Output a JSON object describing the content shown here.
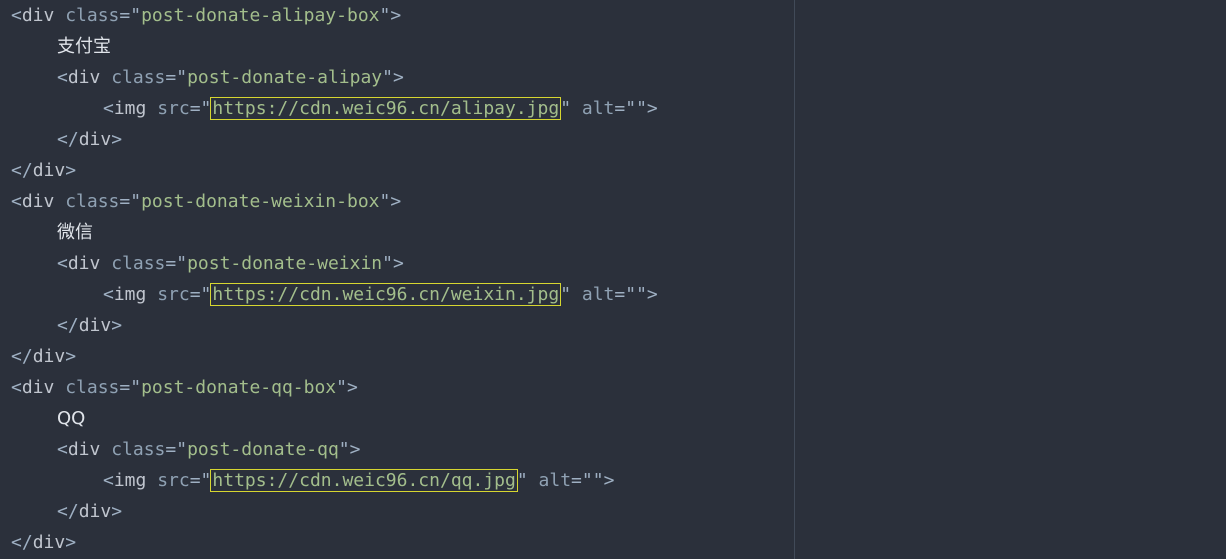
{
  "code_lines": [
    {
      "type": "open",
      "indent": 0,
      "tag": "div",
      "attr": "class",
      "value": "post-donate-alipay-box"
    },
    {
      "type": "text",
      "indent": 1,
      "text": "支付宝"
    },
    {
      "type": "open",
      "indent": 1,
      "tag": "div",
      "attr": "class",
      "value": "post-donate-alipay"
    },
    {
      "type": "img",
      "indent": 2,
      "tag": "img",
      "attr": "src",
      "url": "https://cdn.weic96.cn/alipay.jpg",
      "alt_attr": "alt",
      "alt_value": ""
    },
    {
      "type": "close",
      "indent": 1,
      "tag": "div"
    },
    {
      "type": "close",
      "indent": 0,
      "tag": "div"
    },
    {
      "type": "open",
      "indent": 0,
      "tag": "div",
      "attr": "class",
      "value": "post-donate-weixin-box"
    },
    {
      "type": "text",
      "indent": 1,
      "text": "微信"
    },
    {
      "type": "open",
      "indent": 1,
      "tag": "div",
      "attr": "class",
      "value": "post-donate-weixin"
    },
    {
      "type": "img",
      "indent": 2,
      "tag": "img",
      "attr": "src",
      "url": "https://cdn.weic96.cn/weixin.jpg",
      "alt_attr": "alt",
      "alt_value": ""
    },
    {
      "type": "close",
      "indent": 1,
      "tag": "div"
    },
    {
      "type": "close",
      "indent": 0,
      "tag": "div"
    },
    {
      "type": "open",
      "indent": 0,
      "tag": "div",
      "attr": "class",
      "value": "post-donate-qq-box"
    },
    {
      "type": "text",
      "indent": 1,
      "text": "QQ"
    },
    {
      "type": "open",
      "indent": 1,
      "tag": "div",
      "attr": "class",
      "value": "post-donate-qq"
    },
    {
      "type": "img",
      "indent": 2,
      "tag": "img",
      "attr": "src",
      "url": "https://cdn.weic96.cn/qq.jpg",
      "alt_attr": "alt",
      "alt_value": ""
    },
    {
      "type": "close",
      "indent": 1,
      "tag": "div"
    },
    {
      "type": "close",
      "indent": 0,
      "tag": "div"
    }
  ],
  "colors": {
    "background": "#2b303b",
    "tag": "#c0c5ce",
    "attribute": "#8fa1b3",
    "string": "#a3be8c",
    "text": "#e0e4ea",
    "link_highlight": "#d6d630",
    "divider": "#414a58"
  }
}
